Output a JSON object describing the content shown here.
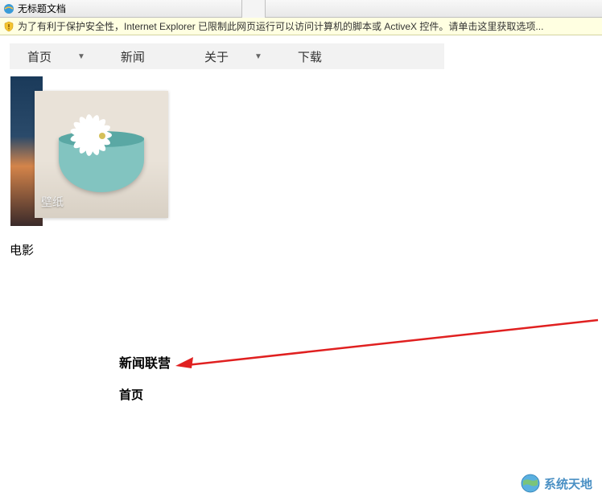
{
  "window": {
    "title": "无标题文档"
  },
  "infobar": {
    "message": "为了有利于保护安全性，Internet Explorer 已限制此网页运行可以访问计算机的脚本或 ActiveX 控件。请单击这里获取选项..."
  },
  "nav": {
    "items": [
      {
        "label": "首页",
        "hasDropdown": true
      },
      {
        "label": "新闻",
        "hasDropdown": false
      },
      {
        "label": "关于",
        "hasDropdown": true
      },
      {
        "label": "下载",
        "hasDropdown": false
      }
    ]
  },
  "thumbnail": {
    "label": "壁纸"
  },
  "labels": {
    "movies": "电影"
  },
  "subcontent": {
    "title": "新闻联营",
    "item": "首页"
  },
  "watermark": {
    "text": "系统天地"
  }
}
